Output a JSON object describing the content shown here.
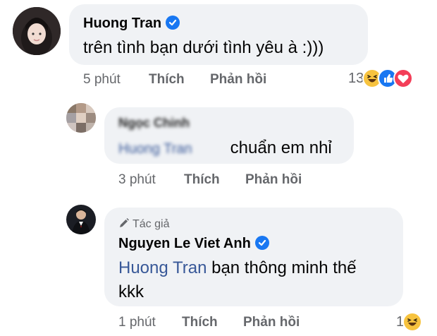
{
  "comments": [
    {
      "author": "Huong Tran",
      "verified": true,
      "text": "trên tình bạn dưới tình yêu à :)))",
      "time": "5 phút",
      "like": "Thích",
      "reply": "Phản hồi",
      "reaction_count": "13",
      "reaction_icons": [
        "haha-icon",
        "like-icon",
        "love-icon"
      ]
    },
    {
      "author": "Ngọc Chinh",
      "verified": false,
      "mention": "Huong Tran",
      "text": "chuẩn em nhỉ",
      "time": "3 phút",
      "like": "Thích",
      "reply": "Phản hồi"
    },
    {
      "author_tag": "Tác giả",
      "author": "Nguyen Le Viet Anh",
      "verified": true,
      "mention": "Huong Tran",
      "text_line1": "bạn thông minh thế",
      "text_line2": "kkk",
      "time": "1 phút",
      "like": "Thích",
      "reply": "Phản hồi",
      "reaction_count": "1",
      "reaction_icons": [
        "haha-icon"
      ]
    }
  ],
  "colors": {
    "bubble": "#f0f2f5",
    "meta": "#65676b",
    "mention": "#385898",
    "verified": "#1877f2"
  }
}
